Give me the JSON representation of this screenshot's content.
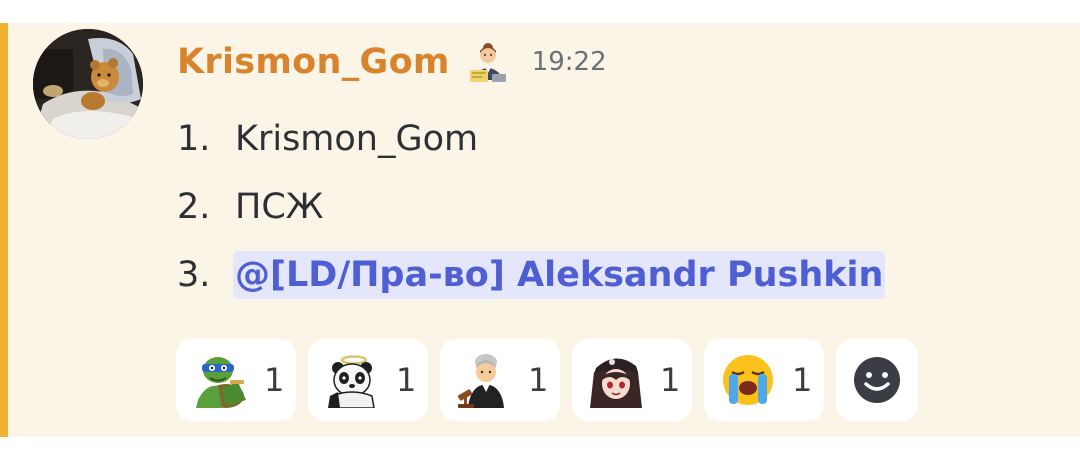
{
  "message": {
    "author": "Krismon_Gom",
    "timestamp": "19:22",
    "role_icon": "office-worker-icon",
    "list_items": [
      {
        "number": "1.",
        "text": "Krismon_Gom"
      },
      {
        "number": "2.",
        "text": "ПСЖ"
      },
      {
        "number": "3.",
        "text": "@[LD/Пра-во] Aleksandr Pushkin",
        "is_mention": true
      }
    ]
  },
  "reactions": [
    {
      "emoji": "ninja-turtle-emoji",
      "count": "1"
    },
    {
      "emoji": "panda-angel-emoji",
      "count": "1"
    },
    {
      "emoji": "judge-emoji",
      "count": "1"
    },
    {
      "emoji": "anime-girl-emoji",
      "count": "1"
    },
    {
      "emoji": "loudly-crying-face-emoji",
      "count": "1"
    }
  ],
  "colors": {
    "highlight_bar": "#f0b232",
    "message_bg": "#fbf5e7",
    "username": "#d9832c",
    "mention_bg": "#e4e7fb",
    "mention_text": "#4f5fd3"
  }
}
